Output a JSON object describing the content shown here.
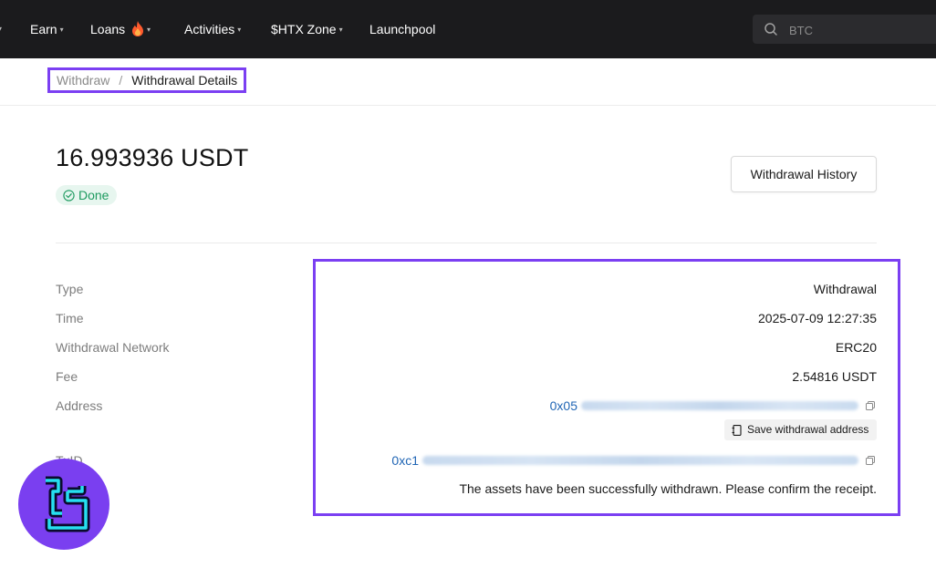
{
  "nav": {
    "items": [
      {
        "label": "Earn",
        "has_caret": true
      },
      {
        "label": "Loans",
        "has_caret": true,
        "icon": "fire-icon"
      },
      {
        "label": "Activities",
        "has_caret": true
      },
      {
        "label": "$HTX Zone",
        "has_caret": true
      },
      {
        "label": "Launchpool",
        "has_caret": false
      }
    ],
    "search": {
      "placeholder": "BTC",
      "icon": "search-icon"
    }
  },
  "breadcrumb": {
    "parent": "Withdraw",
    "separator": "/",
    "current": "Withdrawal Details"
  },
  "header": {
    "amount": "16.993936 USDT",
    "status": "Done",
    "history_button": "Withdrawal History"
  },
  "details": {
    "type_label": "Type",
    "type_value": "Withdrawal",
    "time_label": "Time",
    "time_value": "2025-07-09 12:27:35",
    "network_label": "Withdrawal Network",
    "network_value": "ERC20",
    "fee_label": "Fee",
    "fee_value": "2.54816 USDT",
    "address_label": "Address",
    "address_prefix": "0x05",
    "save_address_button": "Save withdrawal address",
    "txid_label": "TxID",
    "txid_prefix": "0xc1",
    "note": "The assets have been successfully withdrawn. Please confirm the receipt."
  },
  "colors": {
    "accent_highlight": "#7b3ff2",
    "status_green": "#1d9a5f",
    "link_blue": "#2166b5",
    "topbar": "#1b1b1d"
  }
}
